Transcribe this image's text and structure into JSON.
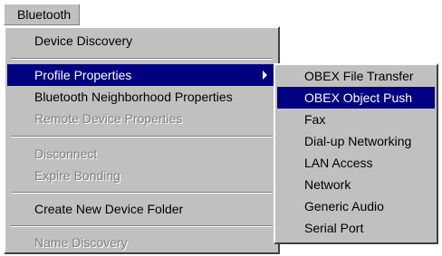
{
  "menubar": {
    "title": "Bluetooth"
  },
  "menu": {
    "items": [
      {
        "label": "Device Discovery",
        "enabled": true
      },
      {
        "label": "Profile Properties",
        "enabled": true,
        "highlighted": true,
        "has_submenu": true,
        "submenu_icon": "chevron-right-icon"
      },
      {
        "label": "Bluetooth Neighborhood Properties",
        "enabled": true
      },
      {
        "label": "Remote Device Properties",
        "enabled": false
      },
      {
        "label": "Disconnect",
        "enabled": false
      },
      {
        "label": "Expire Bonding",
        "enabled": false
      },
      {
        "label": "Create New Device Folder",
        "enabled": true
      },
      {
        "label": "Name Discovery",
        "enabled": false
      }
    ]
  },
  "submenu": {
    "items": [
      {
        "label": "OBEX File Transfer",
        "highlighted": false
      },
      {
        "label": "OBEX Object Push",
        "highlighted": true
      },
      {
        "label": "Fax",
        "highlighted": false
      },
      {
        "label": "Dial-up Networking",
        "highlighted": false
      },
      {
        "label": "LAN Access",
        "highlighted": false
      },
      {
        "label": "Network",
        "highlighted": false
      },
      {
        "label": "Generic Audio",
        "highlighted": false
      },
      {
        "label": "Serial Port",
        "highlighted": false
      }
    ]
  },
  "colors": {
    "menu_bg": "#c0c0c0",
    "highlight_bg": "#000080",
    "highlight_text": "#ffffff",
    "disabled_text": "#808080"
  }
}
